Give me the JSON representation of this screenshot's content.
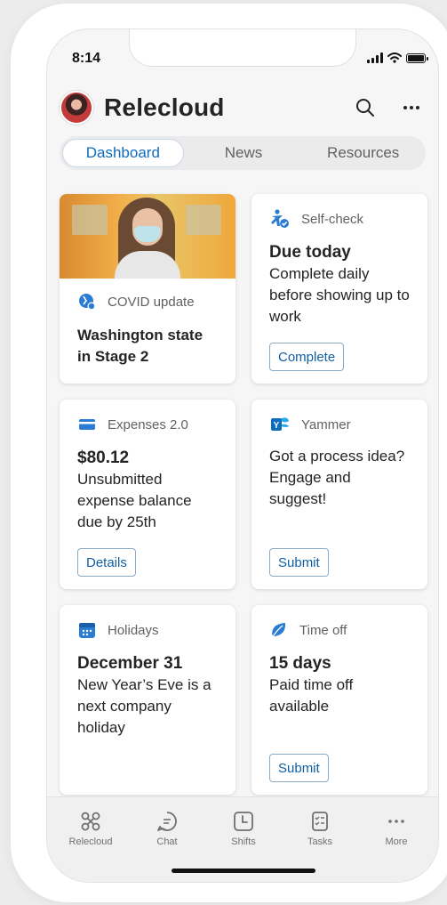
{
  "status_bar": {
    "time": "8:14"
  },
  "header": {
    "title": "Relecloud"
  },
  "tabs": [
    {
      "label": "Dashboard",
      "active": true
    },
    {
      "label": "News",
      "active": false
    },
    {
      "label": "Resources",
      "active": false
    }
  ],
  "cards": {
    "covid": {
      "app": "COVID update",
      "title": "Washington state in Stage 2"
    },
    "selfcheck": {
      "app": "Self-check",
      "title": "Due today",
      "text": "Complete daily before showing up to work",
      "button": "Complete"
    },
    "expenses": {
      "app": "Expenses 2.0",
      "title": "$80.12",
      "text": "Unsubmitted expense balance due by 25th",
      "button": "Details"
    },
    "yammer": {
      "app": "Yammer",
      "text": "Got a process idea? Engage and suggest!",
      "button": "Submit"
    },
    "holidays": {
      "app": "Holidays",
      "title": "December 31",
      "text": "New Year’s Eve is a next company holiday"
    },
    "timeoff": {
      "app": "Time off",
      "title": "15 days",
      "text": "Paid time off available",
      "button": "Submit"
    }
  },
  "tabbar": [
    {
      "label": "Relecloud",
      "icon": "relecloud-icon"
    },
    {
      "label": "Chat",
      "icon": "chat-icon"
    },
    {
      "label": "Shifts",
      "icon": "shifts-icon"
    },
    {
      "label": "Tasks",
      "icon": "tasks-icon"
    },
    {
      "label": "More",
      "icon": "more-icon"
    }
  ],
  "colors": {
    "accent": "#0f6cbd",
    "button_border": "#8aa9c2",
    "background": "#f6f6f6"
  }
}
